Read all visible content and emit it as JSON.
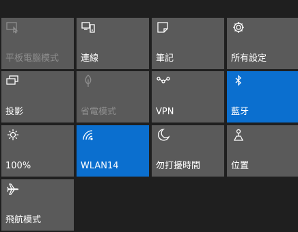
{
  "quick_actions": {
    "tiles": [
      {
        "label": "平板電腦模式",
        "icon": "tablet-mode-icon",
        "state": "disabled"
      },
      {
        "label": "連線",
        "icon": "connect-icon",
        "state": "off"
      },
      {
        "label": "筆記",
        "icon": "note-icon",
        "state": "off"
      },
      {
        "label": "所有設定",
        "icon": "gear-icon",
        "state": "off"
      },
      {
        "label": "投影",
        "icon": "project-icon",
        "state": "off"
      },
      {
        "label": "省電模式",
        "icon": "battery-saver-icon",
        "state": "disabled"
      },
      {
        "label": "VPN",
        "icon": "vpn-icon",
        "state": "off"
      },
      {
        "label": "藍牙",
        "icon": "bluetooth-icon",
        "state": "on"
      },
      {
        "label": "100%",
        "icon": "brightness-icon",
        "state": "off"
      },
      {
        "label": "WLAN14",
        "icon": "wifi-icon",
        "state": "on"
      },
      {
        "label": "勿打擾時間",
        "icon": "moon-icon",
        "state": "off"
      },
      {
        "label": "位置",
        "icon": "location-icon",
        "state": "off"
      },
      {
        "label": "飛航模式",
        "icon": "airplane-icon",
        "state": "off"
      }
    ]
  },
  "colors": {
    "tile_bg": "#5a5a5a",
    "tile_on_bg": "#0b6fcf",
    "panel_bg": "#1f1f1f",
    "disabled_text": "#8f8f8f"
  }
}
